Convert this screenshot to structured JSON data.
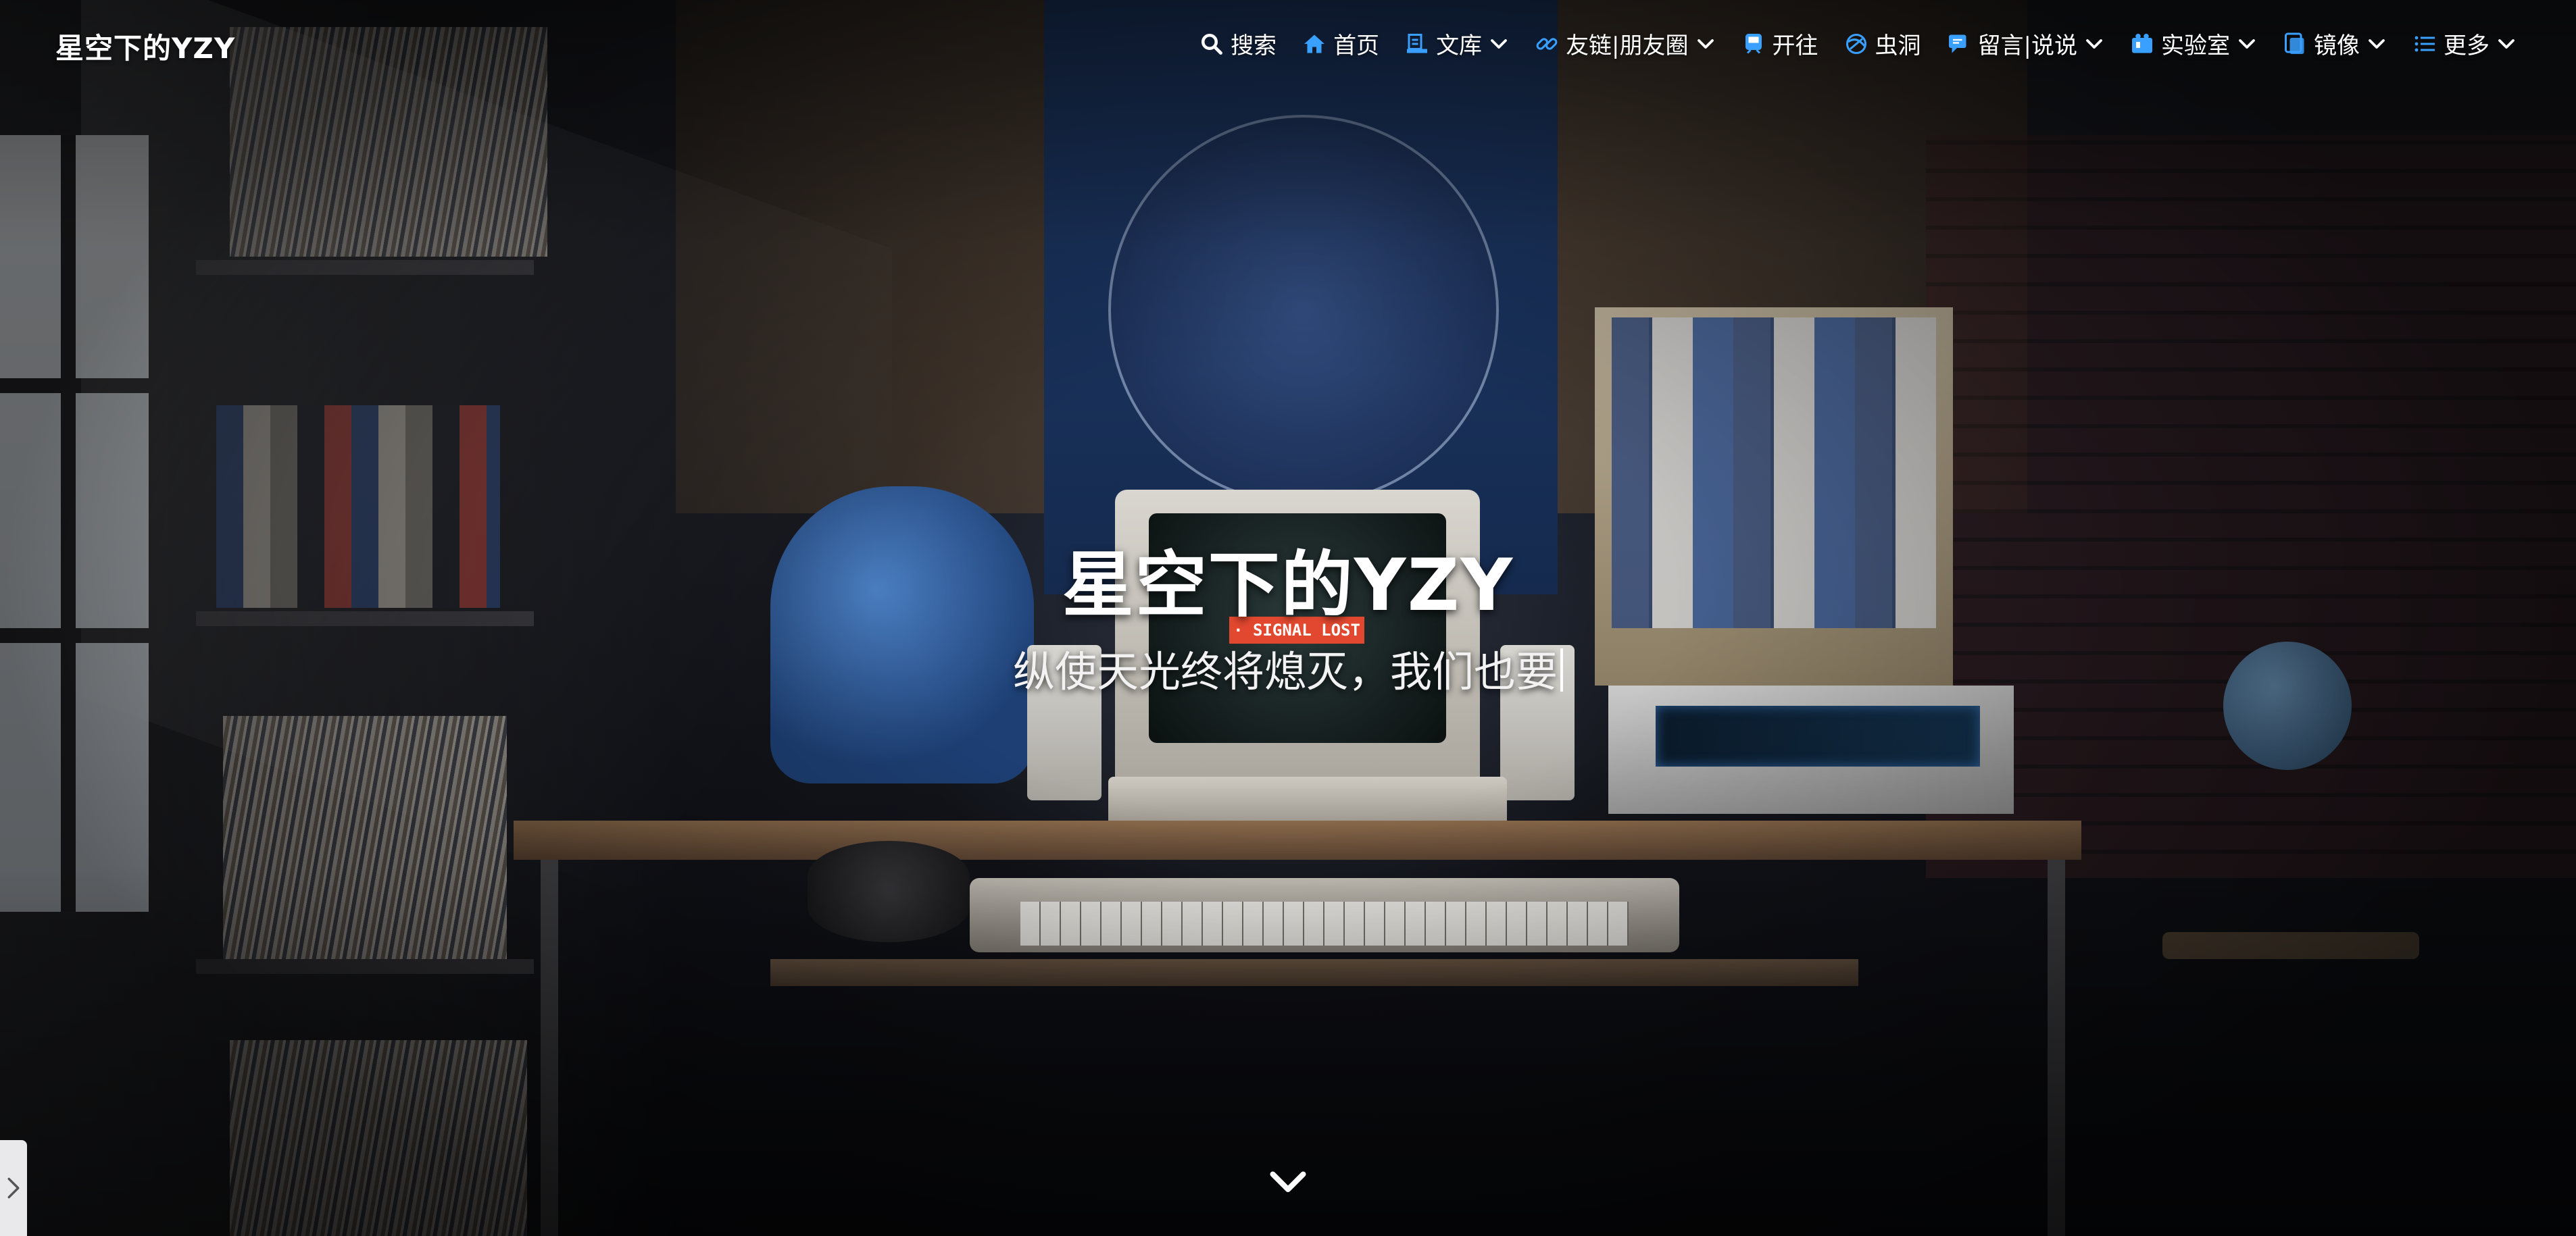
{
  "site": {
    "logo_text": "星空下的YZY"
  },
  "nav": {
    "items": [
      {
        "label": "搜索",
        "icon": "search-icon",
        "has_dropdown": false
      },
      {
        "label": "首页",
        "icon": "home-icon",
        "has_dropdown": false
      },
      {
        "label": "文库",
        "icon": "library-icon",
        "has_dropdown": true
      },
      {
        "label": "友链|朋友圈",
        "icon": "link-icon",
        "has_dropdown": true
      },
      {
        "label": "开往",
        "icon": "train-icon",
        "has_dropdown": false
      },
      {
        "label": "虫洞",
        "icon": "wormhole-icon",
        "has_dropdown": false
      },
      {
        "label": "留言|说说",
        "icon": "comment-icon",
        "has_dropdown": true
      },
      {
        "label": "实验室",
        "icon": "lab-icon",
        "has_dropdown": true
      },
      {
        "label": "镜像",
        "icon": "mirror-icon",
        "has_dropdown": true
      },
      {
        "label": "更多",
        "icon": "list-icon",
        "has_dropdown": true
      }
    ]
  },
  "hero": {
    "title": "星空下的YZY",
    "subtitle": "纵使天光终将熄灭，我们也要"
  },
  "scene": {
    "screen_label": "· SIGNAL LOST ·"
  },
  "colors": {
    "nav_icon": "#3aa0ff",
    "text": "#ffffff",
    "signal_badge": "#e2482f",
    "side_toggle": "#e9e9ec"
  }
}
